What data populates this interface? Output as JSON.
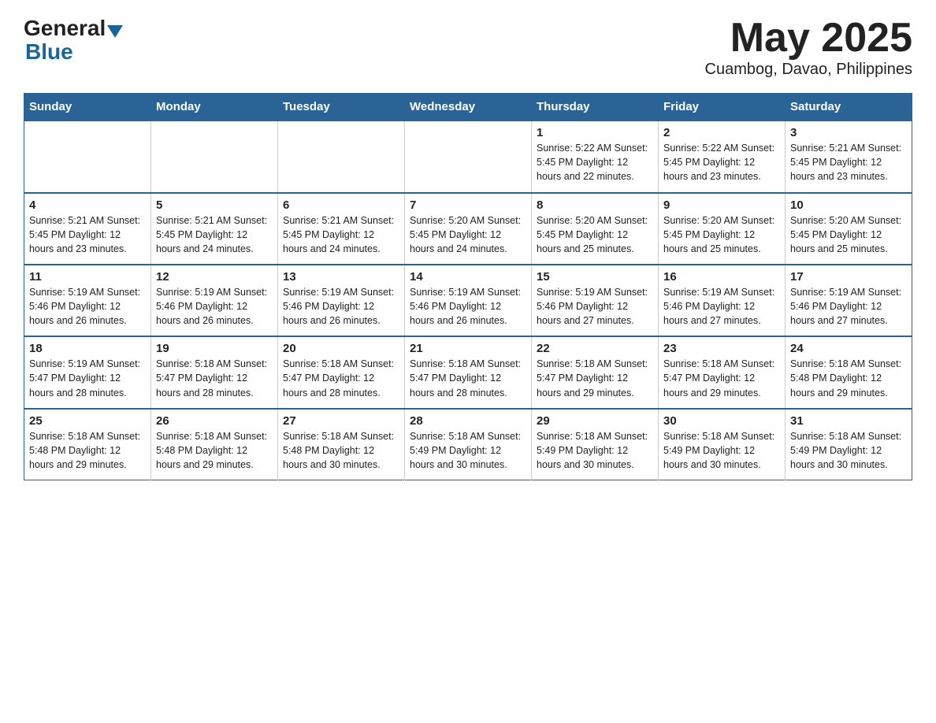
{
  "header": {
    "logo_general": "General",
    "logo_blue": "Blue",
    "title": "May 2025",
    "subtitle": "Cuambog, Davao, Philippines"
  },
  "days_of_week": [
    "Sunday",
    "Monday",
    "Tuesday",
    "Wednesday",
    "Thursday",
    "Friday",
    "Saturday"
  ],
  "weeks": [
    [
      {
        "day": "",
        "info": ""
      },
      {
        "day": "",
        "info": ""
      },
      {
        "day": "",
        "info": ""
      },
      {
        "day": "",
        "info": ""
      },
      {
        "day": "1",
        "info": "Sunrise: 5:22 AM\nSunset: 5:45 PM\nDaylight: 12 hours and 22 minutes."
      },
      {
        "day": "2",
        "info": "Sunrise: 5:22 AM\nSunset: 5:45 PM\nDaylight: 12 hours and 23 minutes."
      },
      {
        "day": "3",
        "info": "Sunrise: 5:21 AM\nSunset: 5:45 PM\nDaylight: 12 hours and 23 minutes."
      }
    ],
    [
      {
        "day": "4",
        "info": "Sunrise: 5:21 AM\nSunset: 5:45 PM\nDaylight: 12 hours and 23 minutes."
      },
      {
        "day": "5",
        "info": "Sunrise: 5:21 AM\nSunset: 5:45 PM\nDaylight: 12 hours and 24 minutes."
      },
      {
        "day": "6",
        "info": "Sunrise: 5:21 AM\nSunset: 5:45 PM\nDaylight: 12 hours and 24 minutes."
      },
      {
        "day": "7",
        "info": "Sunrise: 5:20 AM\nSunset: 5:45 PM\nDaylight: 12 hours and 24 minutes."
      },
      {
        "day": "8",
        "info": "Sunrise: 5:20 AM\nSunset: 5:45 PM\nDaylight: 12 hours and 25 minutes."
      },
      {
        "day": "9",
        "info": "Sunrise: 5:20 AM\nSunset: 5:45 PM\nDaylight: 12 hours and 25 minutes."
      },
      {
        "day": "10",
        "info": "Sunrise: 5:20 AM\nSunset: 5:45 PM\nDaylight: 12 hours and 25 minutes."
      }
    ],
    [
      {
        "day": "11",
        "info": "Sunrise: 5:19 AM\nSunset: 5:46 PM\nDaylight: 12 hours and 26 minutes."
      },
      {
        "day": "12",
        "info": "Sunrise: 5:19 AM\nSunset: 5:46 PM\nDaylight: 12 hours and 26 minutes."
      },
      {
        "day": "13",
        "info": "Sunrise: 5:19 AM\nSunset: 5:46 PM\nDaylight: 12 hours and 26 minutes."
      },
      {
        "day": "14",
        "info": "Sunrise: 5:19 AM\nSunset: 5:46 PM\nDaylight: 12 hours and 26 minutes."
      },
      {
        "day": "15",
        "info": "Sunrise: 5:19 AM\nSunset: 5:46 PM\nDaylight: 12 hours and 27 minutes."
      },
      {
        "day": "16",
        "info": "Sunrise: 5:19 AM\nSunset: 5:46 PM\nDaylight: 12 hours and 27 minutes."
      },
      {
        "day": "17",
        "info": "Sunrise: 5:19 AM\nSunset: 5:46 PM\nDaylight: 12 hours and 27 minutes."
      }
    ],
    [
      {
        "day": "18",
        "info": "Sunrise: 5:19 AM\nSunset: 5:47 PM\nDaylight: 12 hours and 28 minutes."
      },
      {
        "day": "19",
        "info": "Sunrise: 5:18 AM\nSunset: 5:47 PM\nDaylight: 12 hours and 28 minutes."
      },
      {
        "day": "20",
        "info": "Sunrise: 5:18 AM\nSunset: 5:47 PM\nDaylight: 12 hours and 28 minutes."
      },
      {
        "day": "21",
        "info": "Sunrise: 5:18 AM\nSunset: 5:47 PM\nDaylight: 12 hours and 28 minutes."
      },
      {
        "day": "22",
        "info": "Sunrise: 5:18 AM\nSunset: 5:47 PM\nDaylight: 12 hours and 29 minutes."
      },
      {
        "day": "23",
        "info": "Sunrise: 5:18 AM\nSunset: 5:47 PM\nDaylight: 12 hours and 29 minutes."
      },
      {
        "day": "24",
        "info": "Sunrise: 5:18 AM\nSunset: 5:48 PM\nDaylight: 12 hours and 29 minutes."
      }
    ],
    [
      {
        "day": "25",
        "info": "Sunrise: 5:18 AM\nSunset: 5:48 PM\nDaylight: 12 hours and 29 minutes."
      },
      {
        "day": "26",
        "info": "Sunrise: 5:18 AM\nSunset: 5:48 PM\nDaylight: 12 hours and 29 minutes."
      },
      {
        "day": "27",
        "info": "Sunrise: 5:18 AM\nSunset: 5:48 PM\nDaylight: 12 hours and 30 minutes."
      },
      {
        "day": "28",
        "info": "Sunrise: 5:18 AM\nSunset: 5:49 PM\nDaylight: 12 hours and 30 minutes."
      },
      {
        "day": "29",
        "info": "Sunrise: 5:18 AM\nSunset: 5:49 PM\nDaylight: 12 hours and 30 minutes."
      },
      {
        "day": "30",
        "info": "Sunrise: 5:18 AM\nSunset: 5:49 PM\nDaylight: 12 hours and 30 minutes."
      },
      {
        "day": "31",
        "info": "Sunrise: 5:18 AM\nSunset: 5:49 PM\nDaylight: 12 hours and 30 minutes."
      }
    ]
  ]
}
